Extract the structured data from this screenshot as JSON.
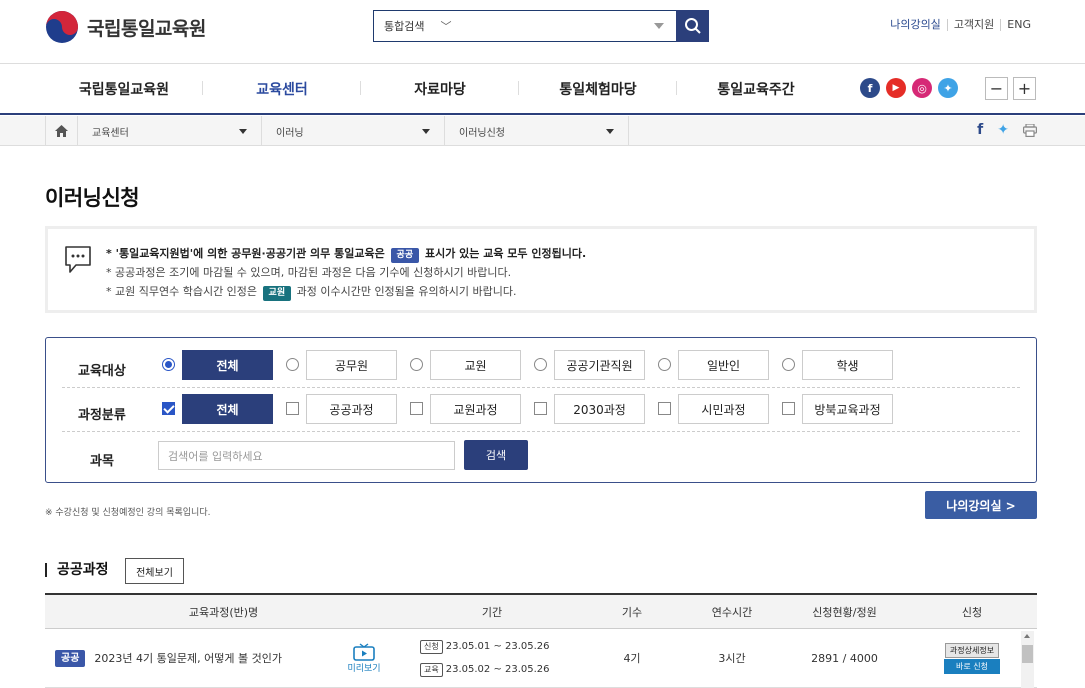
{
  "header": {
    "logo_text": "국립통일교육원",
    "search": {
      "scope": "통합검색",
      "chev": "﹀"
    },
    "util_links": [
      "나의강의실",
      "고객지원",
      "ENG"
    ]
  },
  "gnb": [
    "국립통일교육원",
    "교육센터",
    "자료마당",
    "통일체험마당",
    "통일교육주간"
  ],
  "sns": [
    {
      "name": "facebook",
      "glyph": "f",
      "color": "#2d4a8a"
    },
    {
      "name": "youtube",
      "glyph": "▶",
      "color": "#e52d27"
    },
    {
      "name": "instagram",
      "glyph": "◎",
      "color": "#d62976"
    },
    {
      "name": "twitter",
      "glyph": "✦",
      "color": "#3fa3e6"
    }
  ],
  "zoom": {
    "minus": "−",
    "plus": "+"
  },
  "breadcrumb": [
    "교육센터",
    "이러닝",
    "이러닝신청"
  ],
  "page_title": "이러닝신청",
  "notice": {
    "line1_a": "* '통일교육지원법'에 의한 공무원·공공기관 의무 통일교육은",
    "line1_tag": "공공",
    "line1_b": "표시가 있는 교육 모두 인정됩니다.",
    "line2": "* 공공과정은 조기에 마감될 수 있으며, 마감된 과정은 다음 기수에 신청하시기 바랍니다.",
    "line3_a": "* 교원 직무연수 학습시간 인정은",
    "line3_tag": "교원",
    "line3_b": "과정 이수시간만 인정됨을 유의하시기 바랍니다."
  },
  "filter": {
    "target_label": "교육대상",
    "target_options": [
      "전체",
      "공무원",
      "교원",
      "공공기관직원",
      "일반인",
      "학생"
    ],
    "category_label": "과정분류",
    "category_options": [
      "전체",
      "공공과정",
      "교원과정",
      "2030과정",
      "시민과정",
      "방북교육과정"
    ],
    "subject_label": "과목",
    "subject_placeholder": "검색어를 입력하세요",
    "search_label": "검색"
  },
  "foot_note": "※ 수강신청 및 신청예정인 강의 목록입니다.",
  "my_class_button": "나의강의실 >",
  "section": {
    "title": "공공과정",
    "view_all": "전체보기"
  },
  "table": {
    "headers": [
      "교육과정(반)명",
      "기간",
      "기수",
      "연수시간",
      "신청현황/정원",
      "신청"
    ],
    "rows": [
      {
        "tag": "공공",
        "name": "2023년 4기 통일문제, 어떻게 볼 것인가",
        "preview": "미리보기",
        "apply_tag": "신청",
        "apply_period": "23.05.01 ~ 23.05.26",
        "edu_tag": "교육",
        "edu_period": "23.05.02 ~ 23.05.26",
        "term": "4기",
        "hours": "3시간",
        "status": "2891 / 4000",
        "detail": "과정상세정보",
        "apply": "바로 신청"
      }
    ]
  }
}
